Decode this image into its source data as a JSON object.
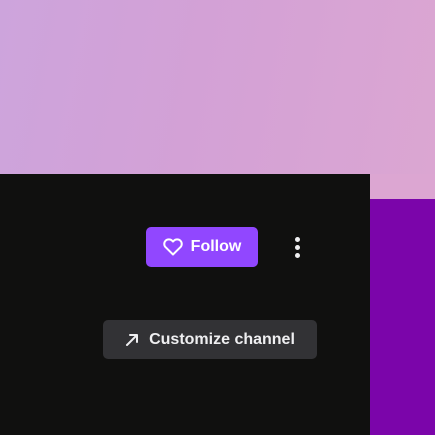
{
  "channel": {
    "follow_label": "Follow",
    "customize_label": "Customize channel"
  },
  "icons": {
    "follow": "heart-icon",
    "more": "more-vertical-icon",
    "customize": "arrow-up-right-icon"
  },
  "colors": {
    "accent": "#9147ff",
    "panel_bg": "#10100f",
    "secondary_button": "#323235",
    "side_strip": "#7b05aa",
    "banner_start": "#cda4dc",
    "banner_end": "#dba6d2"
  }
}
